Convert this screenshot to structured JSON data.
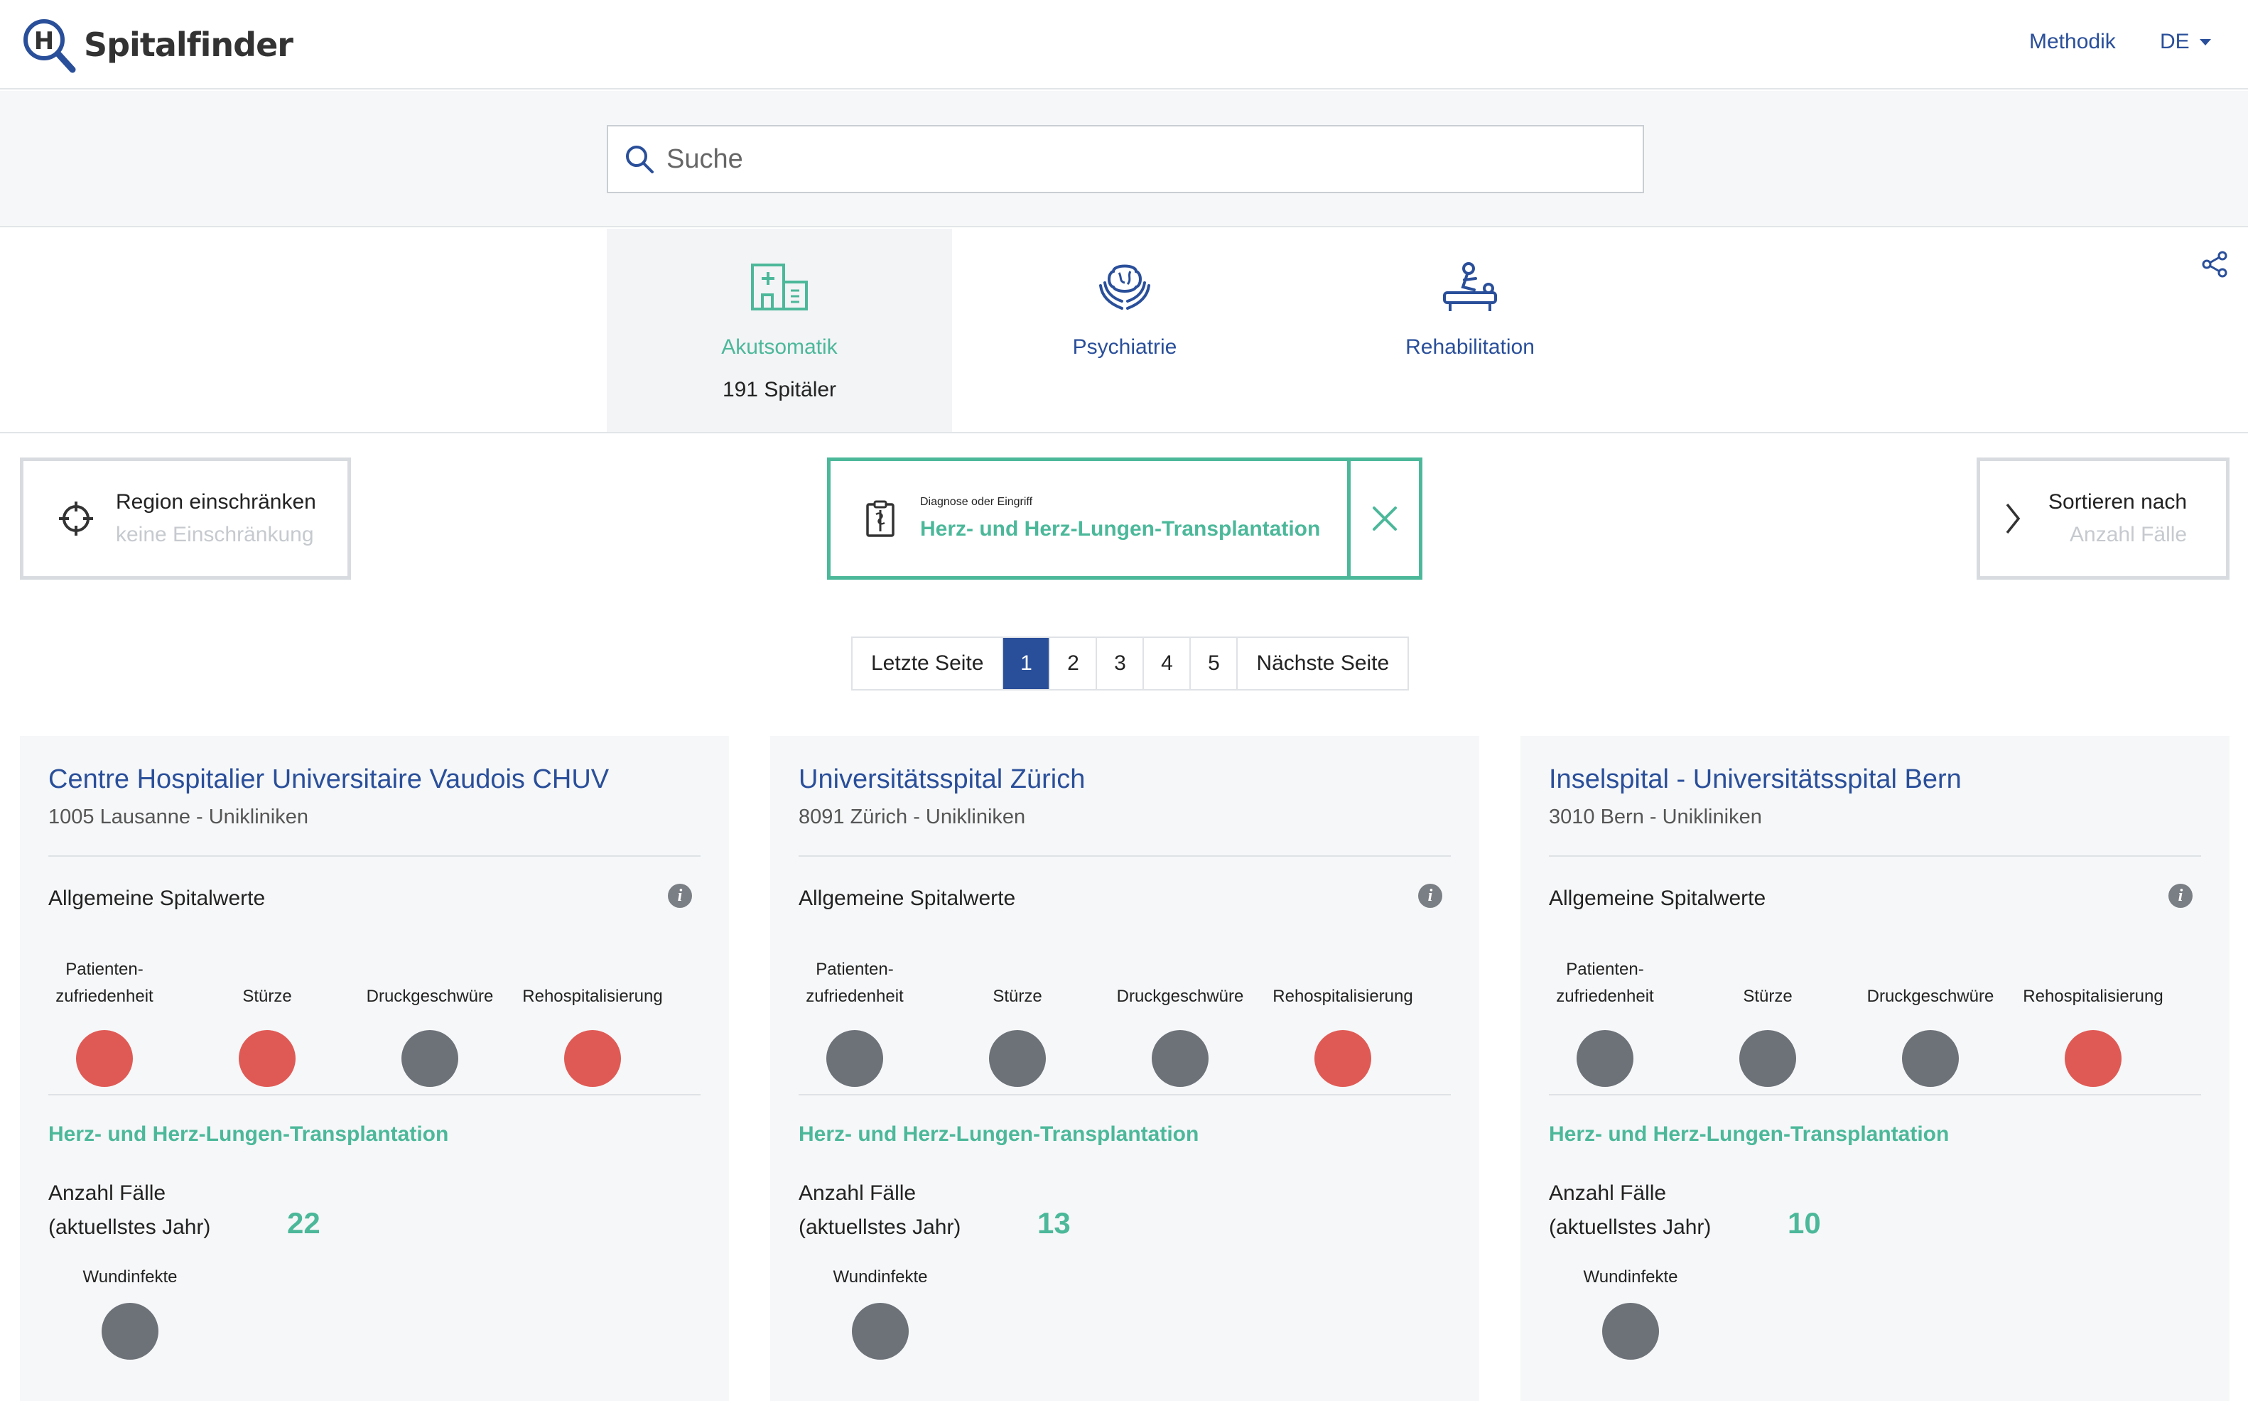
{
  "colors": {
    "brand_blue": "#2a4f9a",
    "accent_green": "#4cb89a",
    "status_red": "#e05a55",
    "status_gray": "#6d7279"
  },
  "header": {
    "app_name": "Spitalfinder",
    "methodik_label": "Methodik",
    "lang_label": "DE"
  },
  "search": {
    "placeholder": "Suche",
    "value": ""
  },
  "tabs": [
    {
      "label": "Akutsomatik",
      "count": "191 Spitäler",
      "icon": "hospital-icon",
      "active": true
    },
    {
      "label": "Psychiatrie",
      "count": "",
      "icon": "brain-hands-icon",
      "active": false
    },
    {
      "label": "Rehabilitation",
      "count": "",
      "icon": "physiotherapy-icon",
      "active": false
    }
  ],
  "filters": {
    "region": {
      "title": "Region einschränken",
      "value": "keine Einschränkung"
    },
    "diagnosis": {
      "title": "Diagnose oder Eingriff",
      "value": "Herz- und Herz-Lungen-Transplantation"
    },
    "sort": {
      "title": "Sortieren nach",
      "value": "Anzahl Fälle"
    }
  },
  "pagination": {
    "prev_label": "Letzte Seite",
    "pages": [
      "1",
      "2",
      "3",
      "4",
      "5"
    ],
    "current": "1",
    "next_label": "Nächste Seite"
  },
  "metric_labels": {
    "satisfaction_line1": "Patienten-",
    "satisfaction_line2": "zufriedenheit",
    "falls": "Stürze",
    "pressure": "Druckgeschwüre",
    "rehosp": "Rehospitalisierung",
    "general_title": "Allgemeine Spitalwerte",
    "cases_line1": "Anzahl Fälle",
    "cases_line2": "(aktuellstes Jahr)",
    "infections": "Wundinfekte"
  },
  "hospitals": [
    {
      "name": "Centre Hospitalier Universitaire Vaudois CHUV",
      "location": "1005 Lausanne - Unikliniken",
      "procedure": "Herz- und Herz-Lungen-Transplantation",
      "cases": "22",
      "status": {
        "satisfaction": "red",
        "falls": "red",
        "pressure": "gray",
        "rehosp": "red",
        "infections": "gray"
      }
    },
    {
      "name": "Universitätsspital Zürich",
      "location": "8091 Zürich - Unikliniken",
      "procedure": "Herz- und Herz-Lungen-Transplantation",
      "cases": "13",
      "status": {
        "satisfaction": "gray",
        "falls": "gray",
        "pressure": "gray",
        "rehosp": "red",
        "infections": "gray"
      }
    },
    {
      "name": "Inselspital - Universitätsspital Bern",
      "location": "3010 Bern - Unikliniken",
      "procedure": "Herz- und Herz-Lungen-Transplantation",
      "cases": "10",
      "status": {
        "satisfaction": "gray",
        "falls": "gray",
        "pressure": "gray",
        "rehosp": "red",
        "infections": "gray"
      }
    }
  ]
}
